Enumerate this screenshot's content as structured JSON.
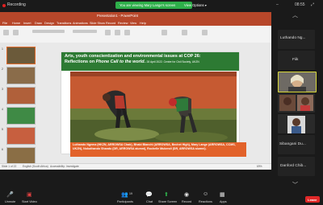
{
  "topbar": {
    "recording_label": "Recording",
    "share_banner": "You are viewing Mary Lange's screen",
    "view_options": "View Options",
    "clock": "08:55"
  },
  "powerpoint": {
    "window_title": "Presentation1 - PowerPoint",
    "tabs": [
      "File",
      "Home",
      "Insert",
      "Draw",
      "Design",
      "Transitions",
      "Animations",
      "Slide Show",
      "Record",
      "Review",
      "View",
      "Help"
    ],
    "thumb_numbers": [
      "1",
      "2",
      "3",
      "4",
      "5",
      "6",
      "7"
    ],
    "status_slide": "Slide 1 of 22",
    "status_lang": "English (South Africa)",
    "status_access": "Accessibility: Investigate",
    "status_zoom": "69%"
  },
  "slide": {
    "title_line1": "Arts, youth conscientization and environmental issues at COP 26:",
    "title_line2_prefix": "Reflections on ",
    "title_line2_italic": "Phone Call to the world",
    "title_line2_suffix": ".",
    "date": "28 April 2022. Centre for Civil Society, UKZN",
    "caption": "Luthando Ngema (HKZN, ARROWSA Chair), Bhabi Blanchi (ARROWSA, Bechet High), Mary Lange (ARROWSA, CCMS, UKZN), Nokuthando Shandu (DR, ARROWSA alumni), Rochelle Mukendi (DR, ARROWSA alumni)."
  },
  "gallery": {
    "tiles": [
      {
        "name": "Luthando Ng..."
      },
      {
        "name": "Fiik"
      },
      {
        "name": ""
      },
      {
        "name": ""
      },
      {
        "name": ""
      },
      {
        "name": "Sibangani Du..."
      },
      {
        "name": "Danford Chib..."
      }
    ]
  },
  "toolbar": {
    "unmute": "Unmute",
    "start_video": "Start Video",
    "participants": "Participants",
    "participants_count": "19",
    "chat": "Chat",
    "share_screen": "Share Screen",
    "record": "Record",
    "reactions": "Reactions",
    "apps": "Apps",
    "leave": "Leave"
  }
}
